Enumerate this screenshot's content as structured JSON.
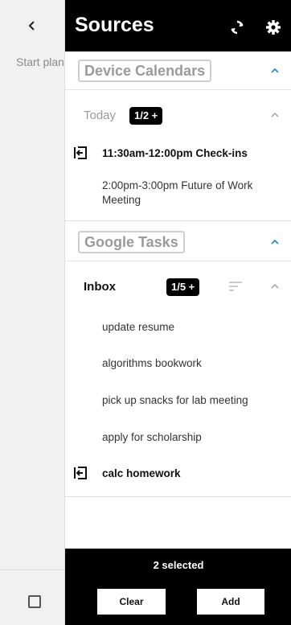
{
  "background": {
    "back_icon": "chevron-left-icon",
    "placeholder": "Start planning",
    "checkbox_icon": "checkbox-icon"
  },
  "drawer": {
    "title": "Sources",
    "icons": {
      "sync": "sync-icon",
      "settings": "gear-icon"
    },
    "sections": {
      "device_calendars": {
        "label": "Device Calendars",
        "group": {
          "label": "Today",
          "count": "1/2 +",
          "items": [
            {
              "text": "11:30am-12:00pm Check-ins",
              "selected": true
            },
            {
              "text": "2:00pm-3:00pm Future of Work Meeting",
              "selected": false
            }
          ]
        }
      },
      "google_tasks": {
        "label": "Google Tasks",
        "group": {
          "label": "Inbox",
          "count": "1/5 +",
          "items": [
            {
              "text": "update resume",
              "selected": false
            },
            {
              "text": "algorithms bookwork",
              "selected": false
            },
            {
              "text": "pick up snacks for lab meeting",
              "selected": false
            },
            {
              "text": "apply for scholarship",
              "selected": false
            },
            {
              "text": "calc homework",
              "selected": true
            }
          ]
        }
      }
    },
    "footer": {
      "selected_text": "2 selected",
      "clear_label": "Clear",
      "add_label": "Add"
    }
  },
  "colors": {
    "topbar": "#000000",
    "accent_blue": "#1e90d6",
    "chip_border": "#cfcfcf"
  }
}
